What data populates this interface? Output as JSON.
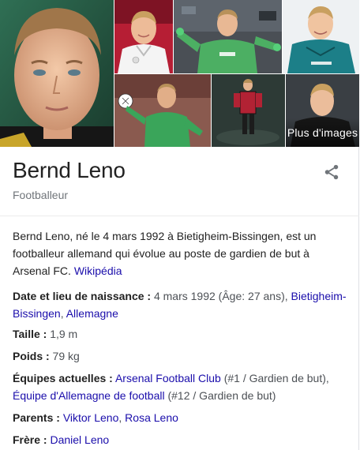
{
  "images": {
    "more_label": "Plus d'images",
    "tiles": [
      {
        "name": "portrait-main",
        "theme": "face"
      },
      {
        "name": "germany-jersey",
        "theme": "white"
      },
      {
        "name": "arsenal-green-kit",
        "theme": "green"
      },
      {
        "name": "arsenal-teal-kit",
        "theme": "teal"
      },
      {
        "name": "arsenal-green-save",
        "theme": "green2"
      },
      {
        "name": "full-body-portrait",
        "theme": "red"
      },
      {
        "name": "black-shirt-portrait",
        "theme": "dark"
      }
    ]
  },
  "entity": {
    "name": "Bernd Leno",
    "type": "Footballeur"
  },
  "description": {
    "text": "Bernd Leno, né le 4 mars 1992 à Bietigheim-Bissingen, est un footballeur allemand qui évolue au poste de gardien de but à Arsenal FC. ",
    "source": "Wikipédia"
  },
  "facts": {
    "birth": {
      "label": "Date et lieu de naissance :",
      "value": " 4 mars 1992 (Âge: 27 ans), ",
      "link1": "Bietigheim-Bissingen",
      "sep": ", ",
      "link2": "Allemagne"
    },
    "height": {
      "label": "Taille :",
      "value": " 1,9 m"
    },
    "weight": {
      "label": "Poids :",
      "value": " 79 kg"
    },
    "teams": {
      "label": "Équipes actuelles :",
      "link1": "Arsenal Football Club",
      "value1": " (#1 / Gardien de but),",
      "link2": "Équipe d'Allemagne de football",
      "value2": " (#12 / Gardien de but)"
    },
    "parents": {
      "label": "Parents :",
      "link1": "Viktor Leno",
      "sep": ", ",
      "link2": "Rosa Leno"
    },
    "brother": {
      "label": "Frère :",
      "link1": "Daniel Leno"
    }
  },
  "colors": {
    "link": "#1a0dab",
    "arsenal_green": "#3ea35a",
    "divider": "#ebebeb"
  }
}
